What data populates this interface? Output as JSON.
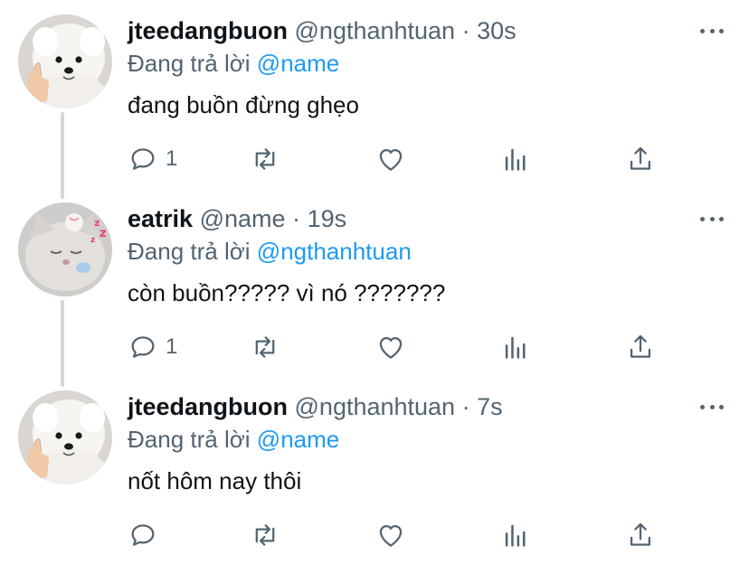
{
  "colors": {
    "text_primary": "#0f1419",
    "text_secondary": "#536471",
    "mention": "#1d9bf0",
    "thread_line": "#cfd9de"
  },
  "tweets": [
    {
      "name": "jteedangbuon",
      "handle": "@ngthanhtuan",
      "separator": "·",
      "time": "30s",
      "reply_prefix": "Đang trả lời",
      "reply_to": "@name",
      "text": "đang buồn đừng ghẹo",
      "reply_count": "1",
      "avatar_icon": "white-dog-avatar"
    },
    {
      "name": "eatrik",
      "handle": "@name",
      "separator": "·",
      "time": "19s",
      "reply_prefix": "Đang trả lời",
      "reply_to": "@ngthanhtuan",
      "text": "còn buồn????? vì nó ???????",
      "reply_count": "1",
      "avatar_icon": "sleeping-cat-avatar"
    },
    {
      "name": "jteedangbuon",
      "handle": "@ngthanhtuan",
      "separator": "·",
      "time": "7s",
      "reply_prefix": "Đang trả lời",
      "reply_to": "@name",
      "text": "nốt hôm nay thôi",
      "reply_count": "",
      "avatar_icon": "white-dog-avatar"
    }
  ]
}
